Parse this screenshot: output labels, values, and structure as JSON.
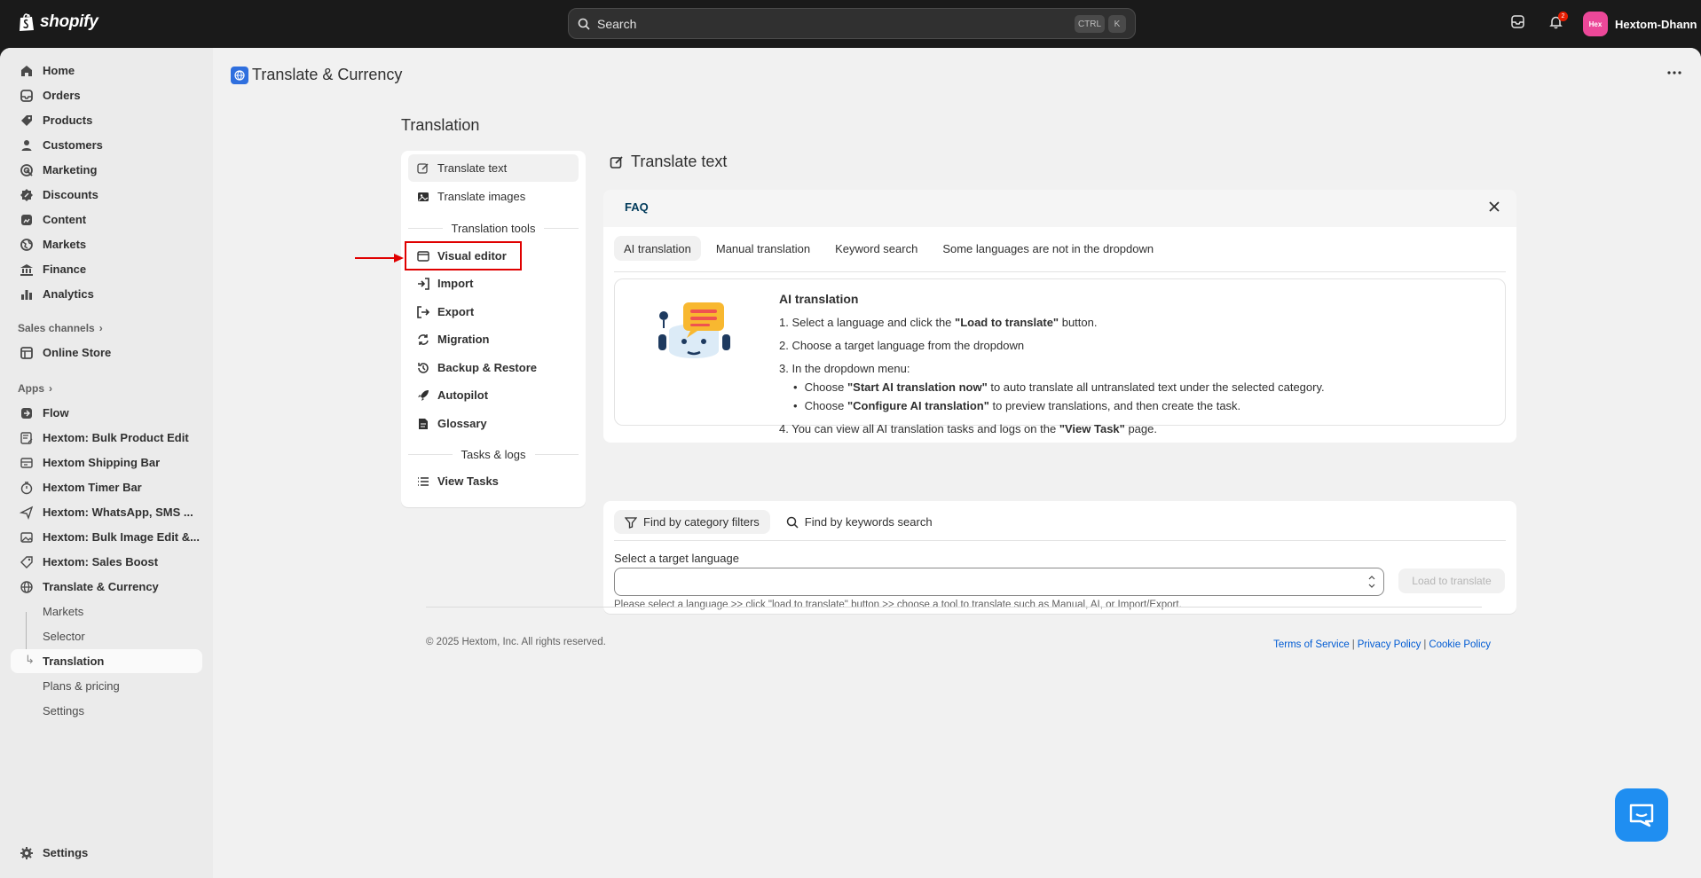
{
  "topbar": {
    "logo": "shopify",
    "search_placeholder": "Search",
    "shortcut_ctrl": "CTRL",
    "shortcut_k": "K",
    "notification_count": "2",
    "avatar_initials": "Hex",
    "user_name": "Hextom-Dhann"
  },
  "sidebar": {
    "items": [
      {
        "label": "Home",
        "icon": "home-icon"
      },
      {
        "label": "Orders",
        "icon": "orders-icon"
      },
      {
        "label": "Products",
        "icon": "tag-icon"
      },
      {
        "label": "Customers",
        "icon": "person-icon"
      },
      {
        "label": "Marketing",
        "icon": "target-icon"
      },
      {
        "label": "Discounts",
        "icon": "discount-icon"
      },
      {
        "label": "Content",
        "icon": "content-icon"
      },
      {
        "label": "Markets",
        "icon": "globe-icon"
      },
      {
        "label": "Finance",
        "icon": "bank-icon"
      },
      {
        "label": "Analytics",
        "icon": "bar-chart-icon"
      }
    ],
    "sales_channels_label": "Sales channels",
    "online_store": "Online Store",
    "apps_label": "Apps",
    "apps": [
      {
        "label": "Flow"
      },
      {
        "label": "Hextom: Bulk Product Edit"
      },
      {
        "label": "Hextom Shipping Bar"
      },
      {
        "label": "Hextom Timer Bar"
      },
      {
        "label": "Hextom: WhatsApp, SMS ..."
      },
      {
        "label": "Hextom: Bulk Image Edit &..."
      },
      {
        "label": "Hextom: Sales Boost"
      },
      {
        "label": "Translate & Currency"
      }
    ],
    "subitems": [
      "Markets",
      "Selector",
      "Translation",
      "Plans & pricing",
      "Settings"
    ],
    "settings": "Settings"
  },
  "main": {
    "app_title": "Translate & Currency",
    "section_title": "Translation",
    "menu": {
      "translate_text": "Translate text",
      "translate_images": "Translate images",
      "tools_header": "Translation tools",
      "visual_editor": "Visual editor",
      "import": "Import",
      "export": "Export",
      "migration": "Migration",
      "backup_restore": "Backup & Restore",
      "autopilot": "Autopilot",
      "glossary": "Glossary",
      "tasks_header": "Tasks & logs",
      "view_tasks": "View Tasks"
    },
    "right_title": "Translate text",
    "faq": {
      "label": "FAQ",
      "tabs": [
        "AI translation",
        "Manual translation",
        "Keyword search",
        "Some languages are not in the dropdown"
      ],
      "ai_title": "AI translation",
      "step1_pre": "1. Select a language and click the ",
      "step1_bold": "\"Load to translate\"",
      "step1_post": " button.",
      "step2": "2. Choose a target language from the dropdown",
      "step3": "3. In the dropdown menu:",
      "bullet1_pre": "Choose ",
      "bullet1_bold": "\"Start AI translation now\"",
      "bullet1_post": " to auto translate all untranslated text under the selected category.",
      "bullet2_pre": "Choose ",
      "bullet2_bold": "\"Configure AI translation\"",
      "bullet2_post": " to preview translations, and then create the task.",
      "step4_pre": "4. You can view all AI translation tasks and logs on the ",
      "step4_bold": "\"View Task\"",
      "step4_post": " page."
    },
    "language": {
      "tab_category": "Find by category filters",
      "tab_keywords": "Find by keywords search",
      "select_label": "Select a target language",
      "select_value": "",
      "load_button": "Load to translate",
      "hint": "Please select a language >> click \"load to translate\" button >> choose a tool to translate such as Manual, AI, or Import/Export."
    },
    "footer": {
      "copyright": "© 2025 Hextom, Inc. All rights reserved.",
      "terms": "Terms of Service",
      "privacy": "Privacy Policy",
      "cookie": "Cookie Policy",
      "sep": "|"
    }
  },
  "colors": {
    "accent": "#005bd3",
    "highlight": "#e00000",
    "topbar": "#1a1a1a",
    "chat": "#1f8ef1"
  }
}
